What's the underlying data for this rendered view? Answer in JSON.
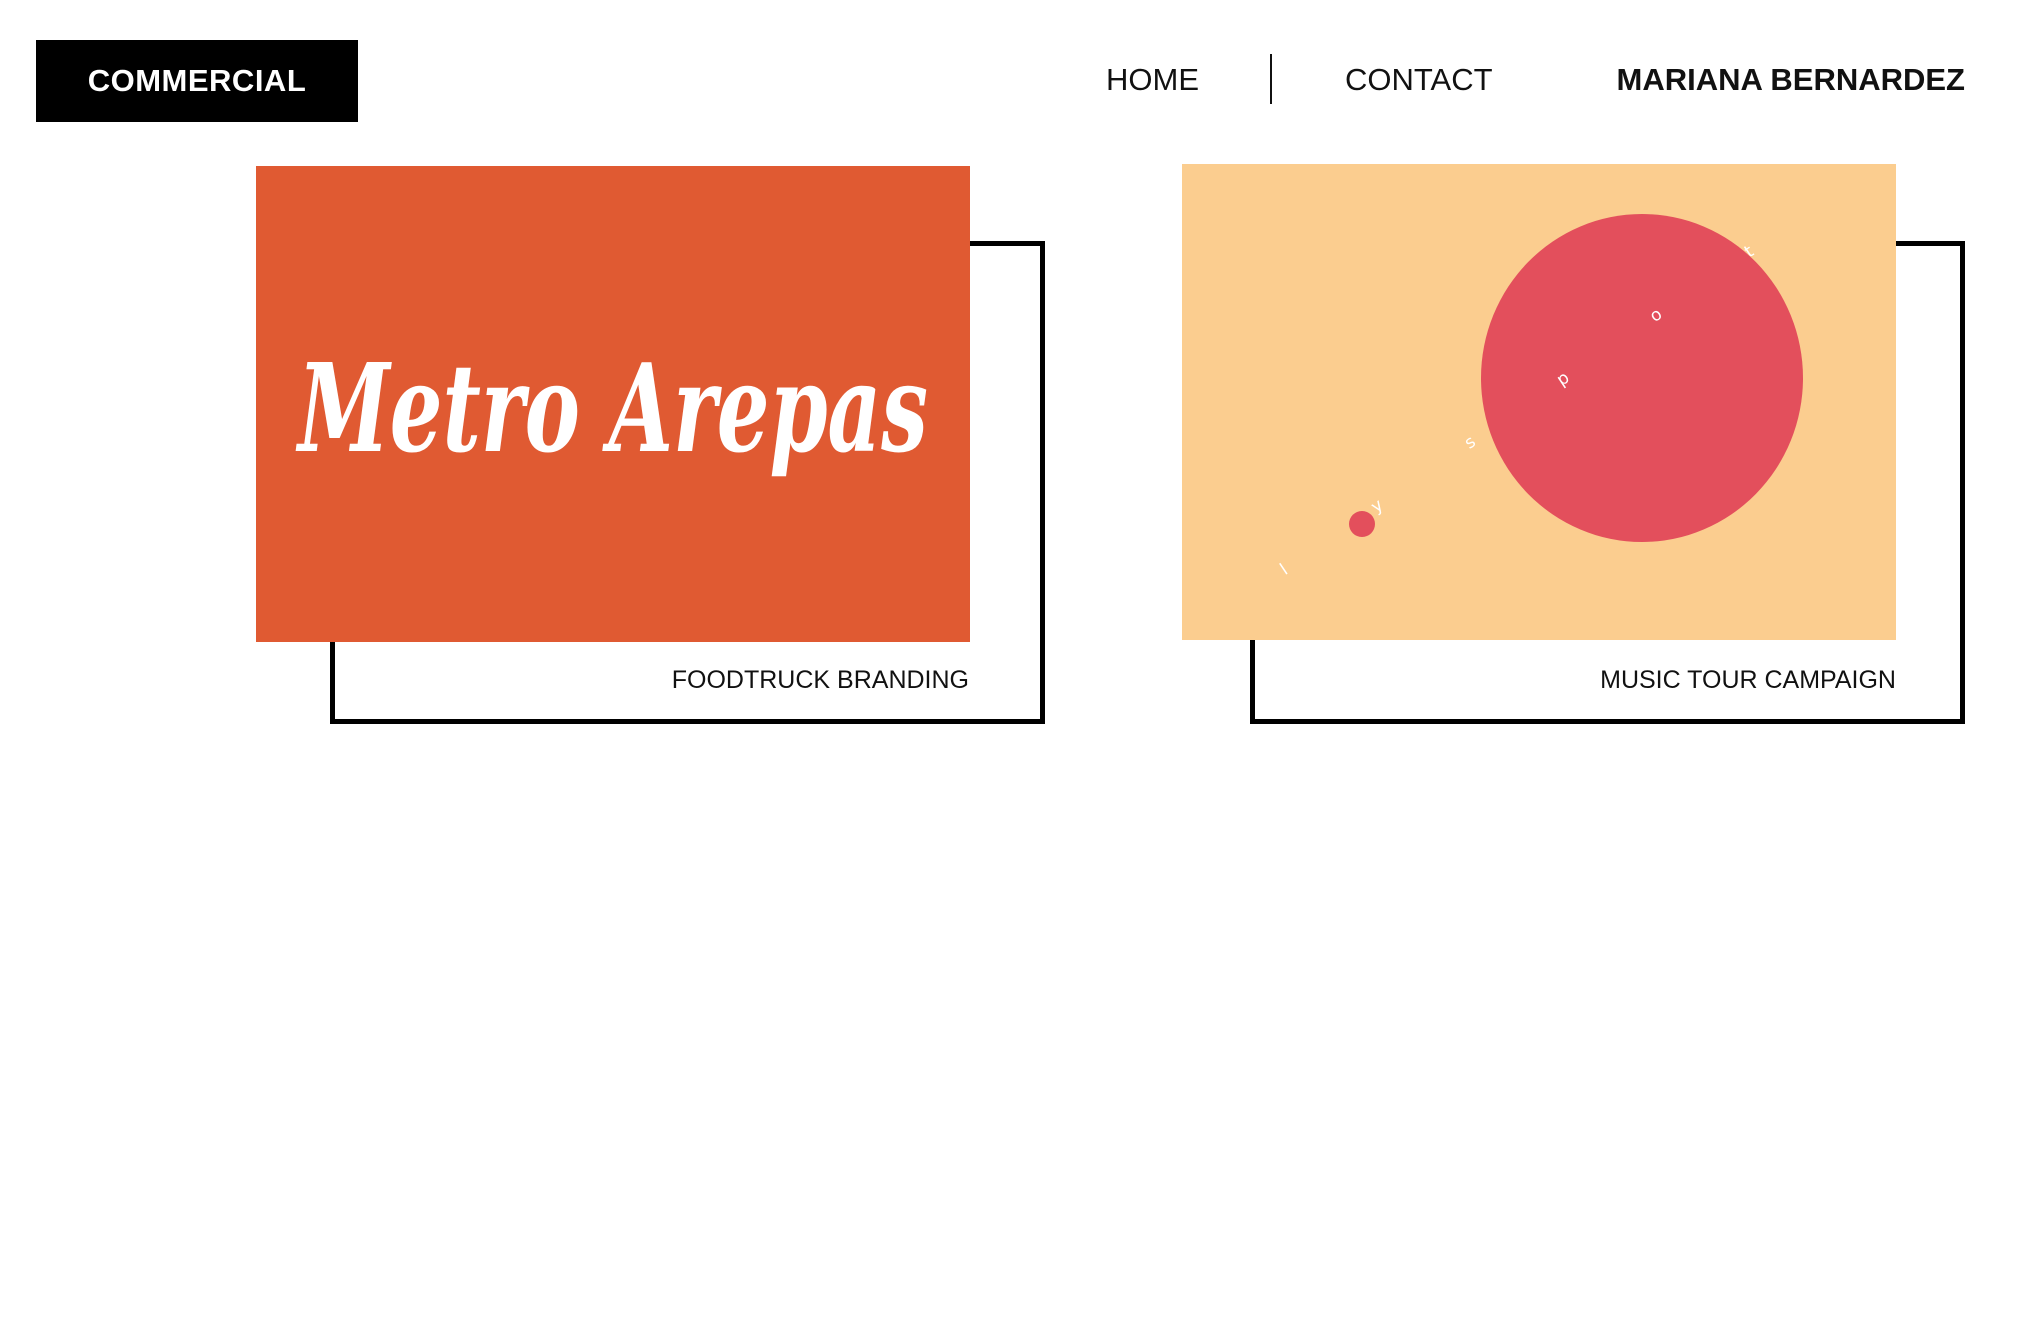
{
  "header": {
    "category_label": "COMMERCIAL",
    "nav": [
      {
        "label": "HOME"
      },
      {
        "label": "CONTACT"
      }
    ],
    "owner_name": "MARIANA BERNARDEZ"
  },
  "projects": [
    {
      "artwork_text": "Metro Arepas",
      "artwork_background": "#E05A32",
      "artwork_text_color": "#FFFFFF",
      "caption": "FOODTRUCK BRANDING"
    },
    {
      "artwork_text": "lyspot",
      "artwork_background": "#FBCD8F",
      "artwork_accent": "#E34F5C",
      "artwork_text_color": "#FFFFFF",
      "caption": "MUSIC TOUR CAMPAIGN"
    }
  ]
}
